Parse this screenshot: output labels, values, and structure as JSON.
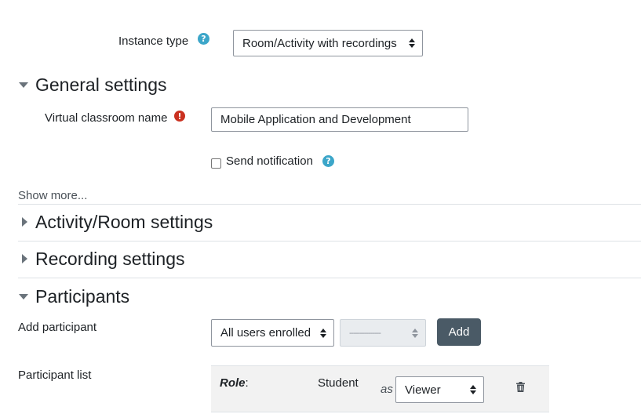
{
  "instance_type": {
    "label": "Instance type",
    "selected": "Room/Activity with recordings"
  },
  "general_settings": {
    "title": "General settings",
    "name_label": "Virtual classroom name",
    "name_value": "Mobile Application and Development",
    "send_notification_label": "Send notification",
    "send_notification_checked": false,
    "show_more": "Show more..."
  },
  "sections": {
    "activity_room": "Activity/Room settings",
    "recording": "Recording settings",
    "participants": "Participants"
  },
  "participants": {
    "add_label": "Add participant",
    "type_selected": "All users enrolled",
    "second_selected": "---------------",
    "add_button": "Add",
    "list_label": "Participant list",
    "rows": [
      {
        "role_label": "Role",
        "role_value": "Student",
        "as_label": "as",
        "permission": "Viewer"
      }
    ]
  },
  "colors": {
    "help_icon": "#3ca6c9",
    "error_icon": "#ca3120",
    "button": "#4a5a66"
  }
}
